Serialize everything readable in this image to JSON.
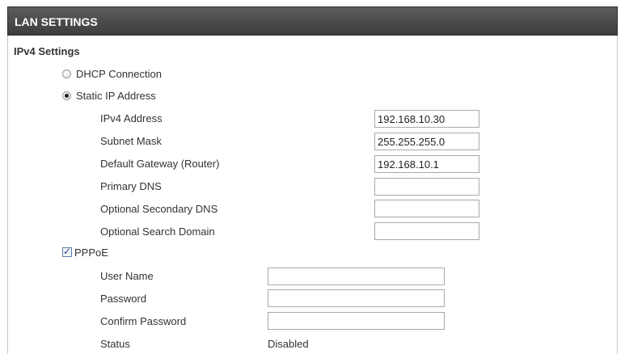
{
  "header": {
    "title": "LAN SETTINGS"
  },
  "ipv4": {
    "section_title": "IPv4 Settings",
    "dhcp_label": "DHCP Connection",
    "dhcp_selected": false,
    "static_label": "Static IP Address",
    "static_selected": true,
    "fields": [
      {
        "label": "IPv4 Address",
        "value": "192.168.10.30"
      },
      {
        "label": "Subnet Mask",
        "value": "255.255.255.0"
      },
      {
        "label": "Default Gateway (Router)",
        "value": "192.168.10.1"
      },
      {
        "label": "Primary DNS",
        "value": ""
      },
      {
        "label": "Optional Secondary DNS",
        "value": ""
      },
      {
        "label": "Optional Search Domain",
        "value": ""
      }
    ]
  },
  "pppoe": {
    "label": "PPPoE",
    "checked": true,
    "user_name_label": "User Name",
    "user_name_value": "",
    "password_label": "Password",
    "password_value": "",
    "confirm_password_label": "Confirm Password",
    "confirm_password_value": "",
    "status_label": "Status",
    "status_value": "Disabled"
  }
}
